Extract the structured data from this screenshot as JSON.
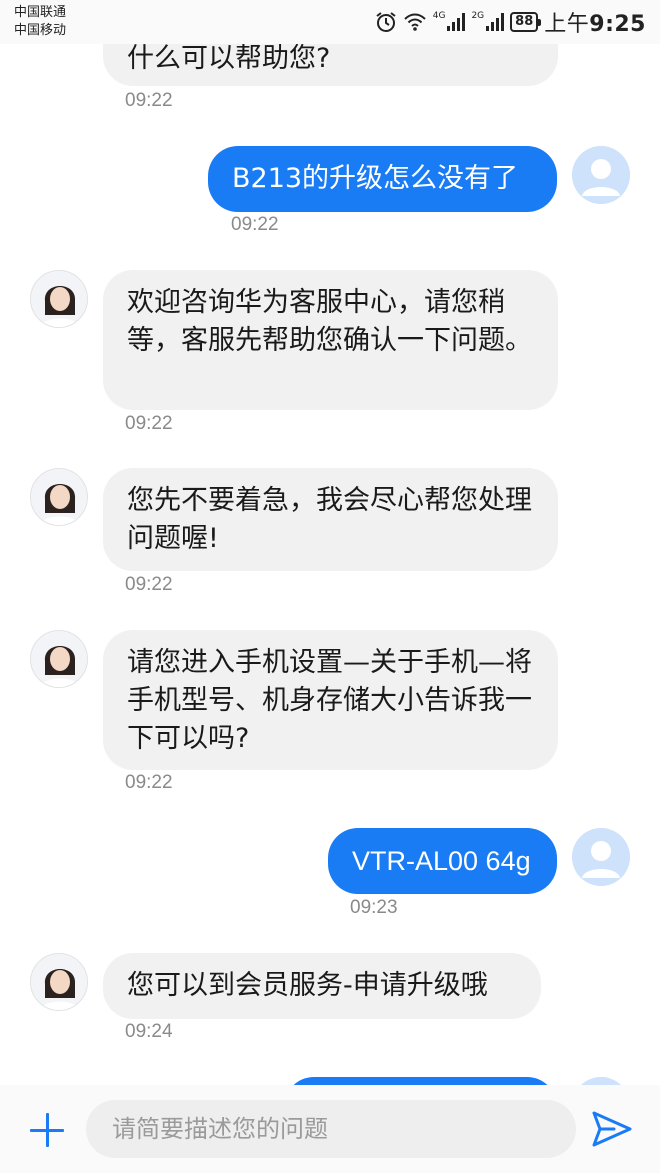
{
  "status_bar": {
    "carrier_1": "中国联通",
    "carrier_2": "中国移动",
    "network_1": "4G",
    "network_2": "2G",
    "battery": "88",
    "time_period": "上午",
    "time": "9:25"
  },
  "messages": [
    {
      "sender": "agent",
      "text": "什么可以帮助您?",
      "time": "09:22"
    },
    {
      "sender": "user",
      "text": "B213的升级怎么没有了",
      "time": "09:22"
    },
    {
      "sender": "agent",
      "text": "欢迎咨询华为客服中心，请您稍等，客服先帮助您确认一下问题。",
      "time": "09:22"
    },
    {
      "sender": "agent",
      "text": "您先不要着急，我会尽心帮您处理问题喔!",
      "time": "09:22"
    },
    {
      "sender": "agent",
      "text": "请您进入手机设置—关于手机—将手机型号、机身存储大小告诉我一下可以吗?",
      "time": "09:22"
    },
    {
      "sender": "user",
      "text": "VTR-AL00 64g",
      "time": "09:23"
    },
    {
      "sender": "agent",
      "text": "您可以到会员服务-申请升级哦",
      "time": "09:24"
    }
  ],
  "input": {
    "placeholder": "请简要描述您的问题",
    "value": ""
  },
  "colors": {
    "accent": "#1a7cf5",
    "incoming_bubble": "#f1f1f1",
    "timestamp": "#8a8a8a"
  },
  "icons": {
    "alarm": "alarm-icon",
    "wifi": "wifi-icon",
    "add": "plus-icon",
    "send": "send-icon"
  }
}
